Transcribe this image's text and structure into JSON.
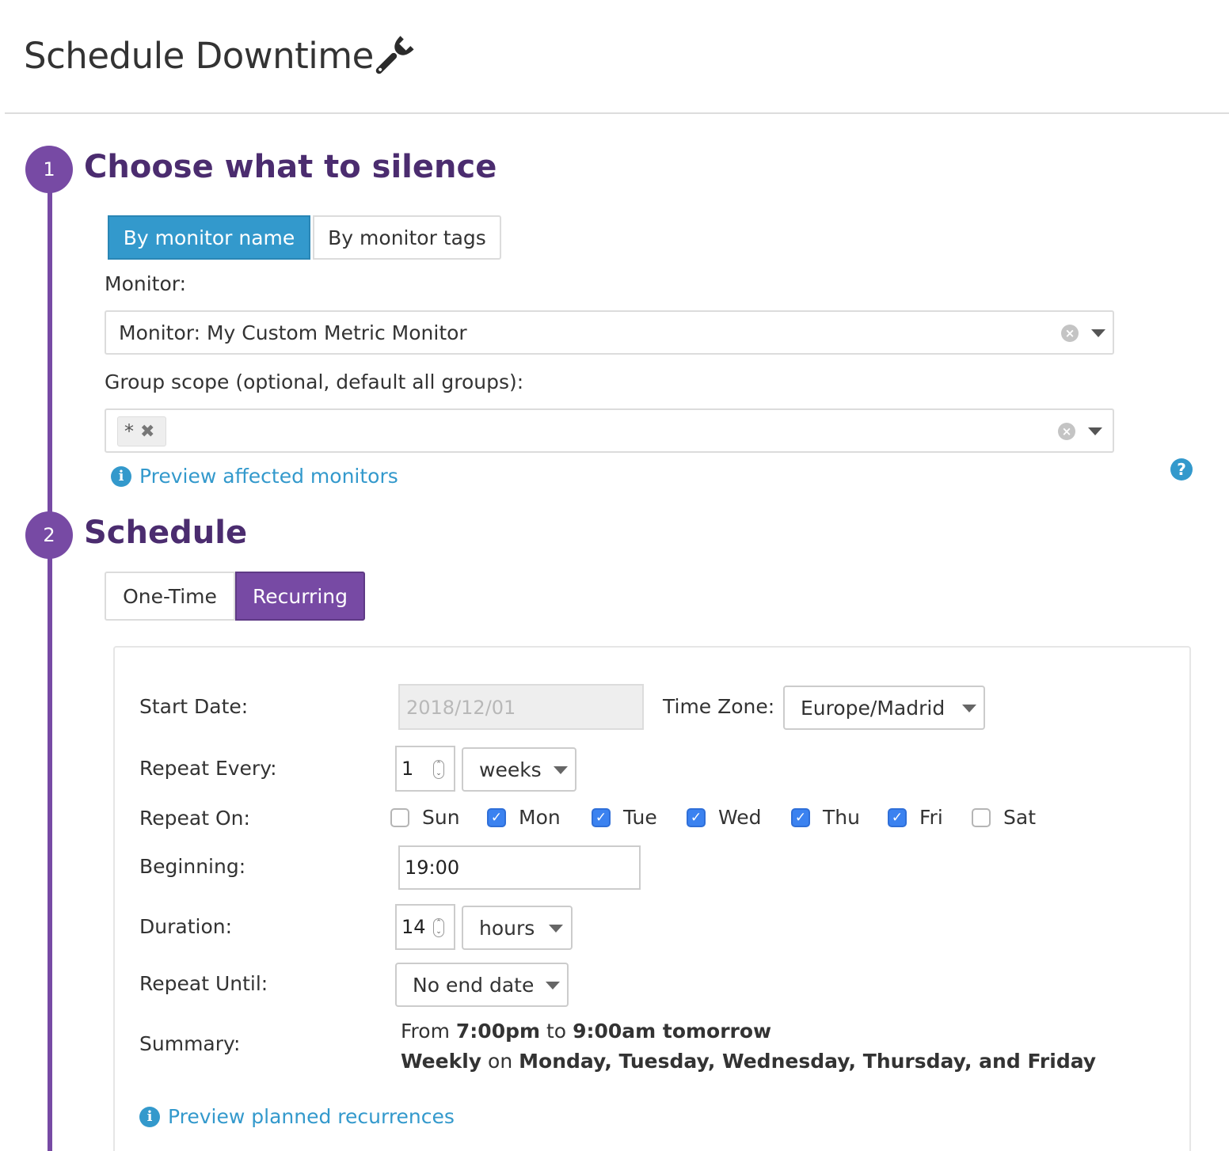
{
  "header": {
    "title": "Schedule Downtime",
    "icon": "wrench-icon"
  },
  "step1": {
    "number": "1",
    "title": "Choose what to silence",
    "tabs": [
      {
        "label": "By monitor name",
        "active": true
      },
      {
        "label": "By monitor tags",
        "active": false
      }
    ],
    "monitor_label": "Monitor:",
    "monitor_value": "Monitor: My Custom Metric Monitor",
    "scope_label": "Group scope (optional, default all groups):",
    "scope_tag": "*",
    "preview_link": "Preview affected monitors"
  },
  "step2": {
    "number": "2",
    "title": "Schedule",
    "tabs": [
      {
        "label": "One-Time",
        "active": false
      },
      {
        "label": "Recurring",
        "active": true
      }
    ],
    "form": {
      "start_date_label": "Start Date:",
      "start_date_value": "2018/12/01",
      "timezone_label": "Time Zone:",
      "timezone_value": "Europe/Madrid",
      "repeat_every_label": "Repeat Every:",
      "repeat_every_number": "1",
      "repeat_every_unit": "weeks",
      "repeat_on_label": "Repeat On:",
      "days": [
        {
          "label": "Sun",
          "checked": false
        },
        {
          "label": "Mon",
          "checked": true
        },
        {
          "label": "Tue",
          "checked": true
        },
        {
          "label": "Wed",
          "checked": true
        },
        {
          "label": "Thu",
          "checked": true
        },
        {
          "label": "Fri",
          "checked": true
        },
        {
          "label": "Sat",
          "checked": false
        }
      ],
      "beginning_label": "Beginning:",
      "beginning_value": "19:00",
      "duration_label": "Duration:",
      "duration_number": "14",
      "duration_unit": "hours",
      "repeat_until_label": "Repeat Until:",
      "repeat_until_value": "No end date",
      "summary_label": "Summary:",
      "summary": {
        "from": "From",
        "start_time": "7:00pm",
        "to": "to",
        "end_time": "9:00am tomorrow",
        "frequency": "Weekly",
        "on": "on",
        "days_text": "Monday, Tuesday, Wednesday, Thursday, and Friday"
      },
      "preview_link": "Preview planned recurrences"
    }
  },
  "colors": {
    "purple": "#774aa4",
    "heading_purple": "#4b2c6f",
    "blue": "#3399cc",
    "checkbox_blue": "#3b82f0"
  }
}
